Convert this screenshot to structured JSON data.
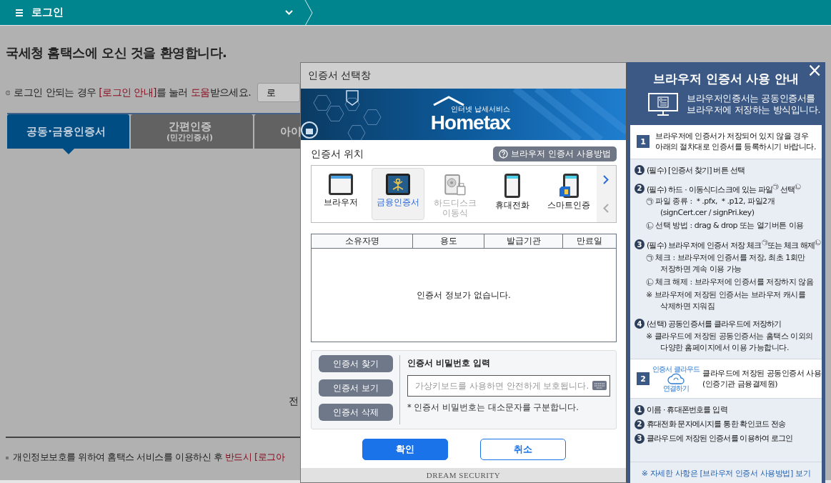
{
  "top_bar": {
    "title": "로그인"
  },
  "page": {
    "welcome": "국세청 홈택스에 오신 것을 환영합니다.",
    "notice": [
      {
        "text": "로그인 안되는 경우 ",
        "highlight": false
      },
      {
        "text": "[로그인 안내]",
        "highlight": true
      },
      {
        "text": "를 눌러 ",
        "highlight": false
      },
      {
        "text": "도움",
        "highlight": true
      },
      {
        "text": "받으세요.",
        "highlight": false
      }
    ],
    "notice_button": "로",
    "tabs": [
      {
        "label": "공동·금융인증서",
        "selected": true
      },
      {
        "label": "간편인증",
        "sublabel": "(민간인증서)",
        "selected": false
      },
      {
        "label": "아이",
        "selected": false
      }
    ],
    "side_text": "전",
    "footer": [
      {
        "text": "개인정보보호를 위하여 홈택스 서비스를 이용하신 후 ",
        "highlight": false
      },
      {
        "text": "반드시 [로그아",
        "highlight": true
      }
    ]
  },
  "dialog": {
    "title": "인증서 선택창",
    "logo_tagline": "인터넷 납세서비스",
    "logo": "Hometax",
    "location_label": "인증서 위치",
    "help_button": "브라우저 인증서 사용방법",
    "locations": [
      {
        "kind": "browser",
        "label": "브라우저",
        "selected": false,
        "disabled": false
      },
      {
        "kind": "finance",
        "label": "금융인증서",
        "selected": true,
        "disabled": false
      },
      {
        "kind": "disk",
        "label": "하드디스크\n이동식",
        "selected": false,
        "disabled": true
      },
      {
        "kind": "phone",
        "label": "휴대전화",
        "selected": false,
        "disabled": false
      },
      {
        "kind": "smart",
        "label": "스마트인증",
        "selected": false,
        "disabled": false
      }
    ],
    "table": {
      "columns": [
        "소유자명",
        "용도",
        "발급기관",
        "만료일"
      ],
      "empty": "인증서 정보가 없습니다."
    },
    "actions": [
      "인증서 찾기",
      "인증서 보기",
      "인증서 삭제"
    ],
    "password_label": "인증서 비밀번호 입력",
    "password_placeholder": "가상키보드를 사용하면 안전하게 보호됩니다.",
    "password_note": "* 인증서 비밀번호는 대소문자를 구분합니다.",
    "buttons": [
      {
        "kind": "primary",
        "label": "확인"
      },
      {
        "kind": "secondary",
        "label": "취소"
      }
    ],
    "vendor": "DREAM SECURITY"
  },
  "guide": {
    "close": "×",
    "title": "브라우저 인증서 사용 안내",
    "intro": [
      "브라우저인증서는 공동인증서를",
      "브라우저에 저장하는 방식입니다."
    ],
    "section_1": {
      "number": "1",
      "lines": [
        "브라우저에 인증서가 저장되어 있지 않을 경우",
        "아래의 절차대로 인증서를 등록하시기 바랍니다."
      ]
    },
    "steps_1": [
      {
        "number": "1",
        "text": "(필수) [인증서 찾기] 버튼 선택"
      },
      {
        "number": "2",
        "text": "(필수) 하드 · 이동식디스크에 있는 파일$^{㉠}$ 선택$^{㉡}$",
        "notes": [
          [
            "㉠ 파일 종류 : ＊.pfx,  ＊.p12, 파일2개",
            "(signCert.cer / signPri.key)"
          ],
          [
            "㉡ 선택 방법 : drag & drop 또는 열기버튼 이용"
          ]
        ]
      },
      {
        "number": "3",
        "text": "(필수) 브라우저에 인증서 저장 체크$^{㉠}$또는 체크 해제$^{㉡}$",
        "notes": [
          [
            "㉠ 체크 : 브라우저에 인증서를 저장, 최초 1회만",
            "저장하면 계속 이용 가능"
          ],
          [
            "㉡ 체크 해제 : 브라우저에 인증서를 저장하지 않음"
          ],
          [
            "※ 브라우저에 저장된 인증서는 브라우저 캐시를",
            "삭제하면 지워짐"
          ]
        ]
      },
      {
        "number": "4",
        "text": "(선택) 공동인증서를 클라우드에 저장하기",
        "notes": [
          [
            "※ 클라우드에 저장된 공동인증서는 홈택스 이외의",
            "다양한 홈페이지에서 이용 가능합니다."
          ]
        ]
      }
    ],
    "section_2": {
      "number": "2",
      "cloud_top": "인증서 클라우드",
      "cloud_bottom": "연결하기",
      "lines": [
        "클라우드에 저장된 공동인증서 사용",
        "(인증기관 금융결제원)"
      ]
    },
    "steps_2": [
      {
        "number": "1",
        "text": "이름 · 휴대폰번호를 입력"
      },
      {
        "number": "2",
        "text": "휴대전화 문자메시지를 통한 확인코드 전송"
      },
      {
        "number": "3",
        "text": "클라우드에 저장된 인증서를 이용하여 로그인"
      }
    ],
    "link": "※ 자세한 사항은 [브라우저 인증서 사용방법] 보기"
  }
}
